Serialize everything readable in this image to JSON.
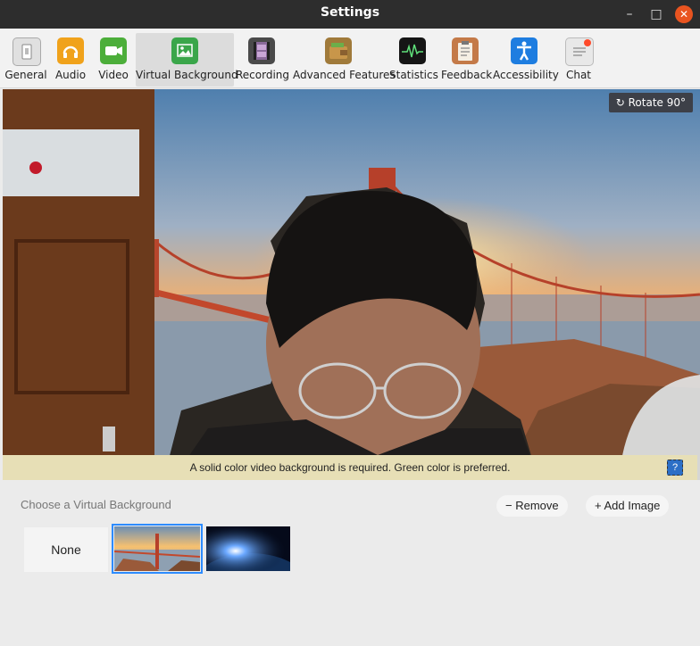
{
  "window": {
    "title": "Settings",
    "min": "–",
    "max": "□",
    "close": "✕"
  },
  "tabs": [
    {
      "label": "General",
      "icon": "general-icon",
      "color": "#d9d9d9"
    },
    {
      "label": "Audio",
      "icon": "headphones-icon",
      "color": "#f0a21b"
    },
    {
      "label": "Video",
      "icon": "video-camera-icon",
      "color": "#4cae3a"
    },
    {
      "label": "Virtual Background",
      "icon": "picture-icon",
      "color": "#3aa64a"
    },
    {
      "label": "Recording",
      "icon": "film-icon",
      "color": "#555555"
    },
    {
      "label": "Advanced Features",
      "icon": "wallet-icon",
      "color": "#a07a3a"
    },
    {
      "label": "Statistics",
      "icon": "pulse-icon",
      "color": "#111111"
    },
    {
      "label": "Feedback",
      "icon": "clipboard-icon",
      "color": "#b56a3a"
    },
    {
      "label": "Accessibility",
      "icon": "accessibility-icon",
      "color": "#1e7de0"
    },
    {
      "label": "Chat",
      "icon": "chat-icon",
      "color": "#e8e8e8"
    }
  ],
  "active_tab": "Virtual Background",
  "preview": {
    "rotate_label": "Rotate 90°",
    "notice": "A solid color video background is required. Green color is preferred.",
    "help": "?"
  },
  "backgrounds": {
    "heading": "Choose a Virtual Background",
    "remove_label": "Remove",
    "add_label": "Add Image",
    "none_label": "None",
    "items": [
      "golden-gate-bridge",
      "earth-from-space"
    ],
    "selected": "golden-gate-bridge"
  },
  "colors": {
    "accent": "#2d8cff",
    "close": "#e95420",
    "notice_bg": "#e7dfb6"
  }
}
